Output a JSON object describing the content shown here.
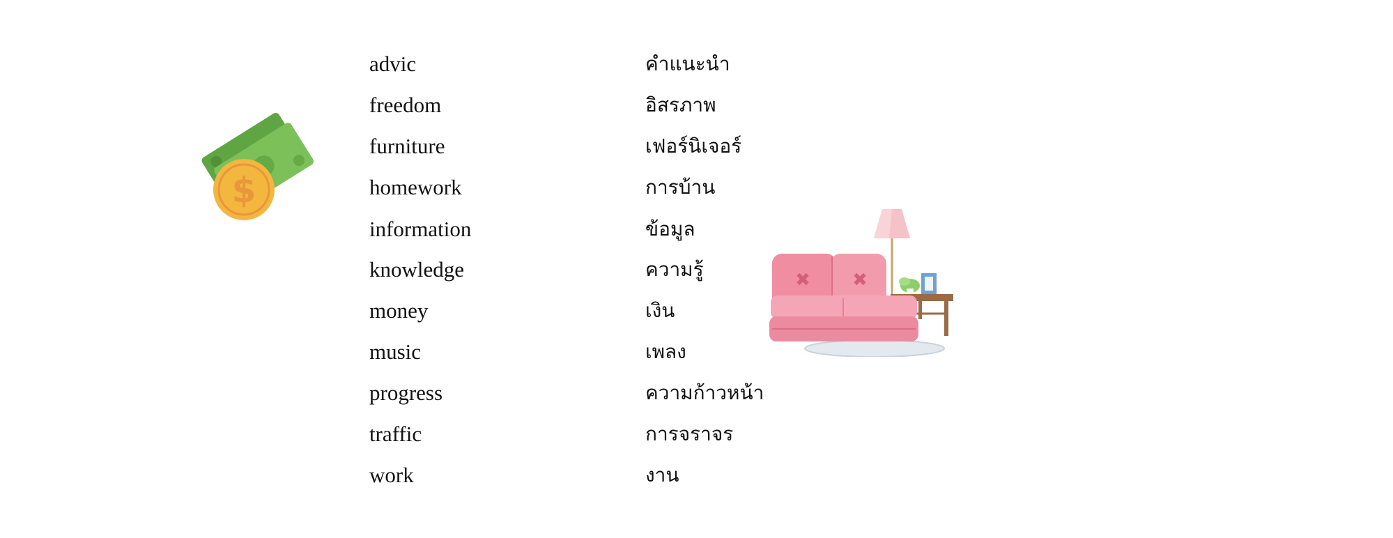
{
  "vocabulary": [
    {
      "en": "advic",
      "th": "คำแนะนำ"
    },
    {
      "en": "freedom",
      "th": "อิสรภาพ"
    },
    {
      "en": "furniture",
      "th": "เฟอร์นิเจอร์"
    },
    {
      "en": "homework",
      "th": "การบ้าน"
    },
    {
      "en": "information",
      "th": "ข้อมูล"
    },
    {
      "en": "knowledge",
      "th": "ความรู้"
    },
    {
      "en": "money",
      "th": "เงิน"
    },
    {
      "en": "music",
      "th": "เพลง"
    },
    {
      "en": "progress",
      "th": "ความก้าวหน้า"
    },
    {
      "en": "traffic",
      "th": "การจราจร"
    },
    {
      "en": "work",
      "th": "งาน"
    }
  ],
  "illustrations": {
    "money": {
      "icon": "money-bills-coin-icon",
      "coin_symbol": "$",
      "bill_color": "#7cc05a",
      "coin_color": "#f3b63f"
    },
    "sofa": {
      "icon": "sofa-lamp-table-icon",
      "sofa_color": "#f08da1",
      "lamp_color": "#f4c2c8",
      "table_color": "#9a6b44"
    }
  }
}
